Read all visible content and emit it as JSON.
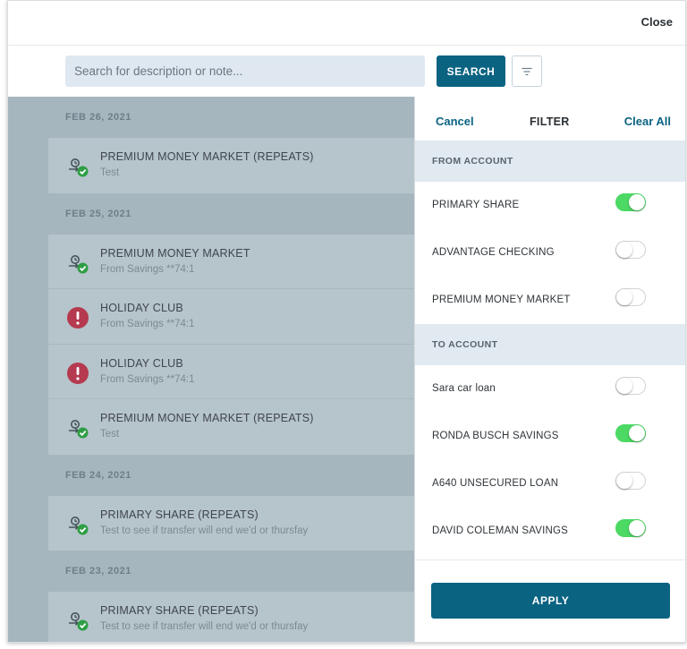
{
  "topbar": {
    "close_label": "Close"
  },
  "search": {
    "placeholder": "Search for description or note...",
    "button_label": "SEARCH",
    "filter_icon": "filter-icon"
  },
  "transactions": {
    "groups": [
      {
        "date": "FEB 26, 2021",
        "items": [
          {
            "icon": "transfer-check-icon",
            "title": "PREMIUM MONEY MARKET (REPEATS)",
            "subtitle": "Test"
          }
        ]
      },
      {
        "date": "FEB 25, 2021",
        "items": [
          {
            "icon": "transfer-check-icon",
            "title": "PREMIUM MONEY MARKET",
            "subtitle": "From Savings **74:1"
          },
          {
            "icon": "alert-icon",
            "title": "HOLIDAY CLUB",
            "subtitle": "From Savings **74:1"
          },
          {
            "icon": "alert-icon",
            "title": "HOLIDAY CLUB",
            "subtitle": "From Savings **74:1"
          },
          {
            "icon": "transfer-check-icon",
            "title": "PREMIUM MONEY MARKET (REPEATS)",
            "subtitle": "Test"
          }
        ]
      },
      {
        "date": "FEB 24, 2021",
        "items": [
          {
            "icon": "transfer-check-icon",
            "title": "PRIMARY SHARE (REPEATS)",
            "subtitle": "Test to see if transfer will end we'd or thursfay"
          }
        ]
      },
      {
        "date": "FEB 23, 2021",
        "items": [
          {
            "icon": "transfer-check-icon",
            "title": "PRIMARY SHARE (REPEATS)",
            "subtitle": "Test to see if transfer will end we'd or thursfay"
          }
        ]
      }
    ]
  },
  "filter_panel": {
    "cancel_label": "Cancel",
    "title": "FILTER",
    "clear_all_label": "Clear All",
    "from_account": {
      "header": "FROM ACCOUNT",
      "items": [
        {
          "label": "PRIMARY SHARE",
          "on": true
        },
        {
          "label": "ADVANTAGE CHECKING",
          "on": false
        },
        {
          "label": "PREMIUM MONEY MARKET",
          "on": false
        }
      ]
    },
    "to_account": {
      "header": "TO ACCOUNT",
      "items": [
        {
          "label": "Sara car loan",
          "on": false
        },
        {
          "label": "RONDA BUSCH SAVINGS",
          "on": true
        },
        {
          "label": "A640 UNSECURED LOAN",
          "on": false
        },
        {
          "label": "DAVID COLEMAN SAVINGS",
          "on": true
        }
      ]
    },
    "apply_label": "APPLY"
  },
  "colors": {
    "primary": "#0b6382",
    "toggle_on": "#4cd964",
    "success": "#2e9e44",
    "alert": "#b53a4f",
    "overlay": "#a5b6bf"
  }
}
